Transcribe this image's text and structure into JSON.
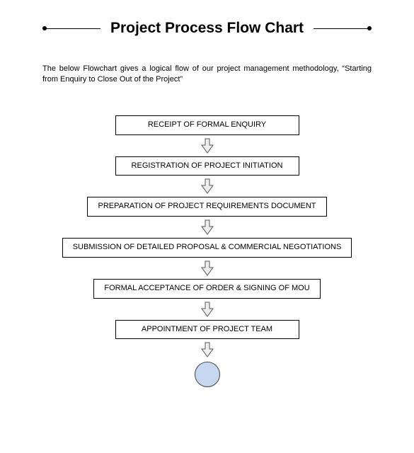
{
  "title": "Project Process Flow Chart",
  "intro": "The below Flowchart gives a logical flow of our project management methodology, “Starting from Enquiry to Close Out of the Project”",
  "steps": {
    "s1": "RECEIPT OF FORMAL ENQUIRY",
    "s2": "REGISTRATION OF PROJECT INITIATION",
    "s3": "PREPARATION OF PROJECT REQUIREMENTS DOCUMENT",
    "s4": "SUBMISSION OF DETAILED PROPOSAL & COMMERCIAL NEGOTIATIONS",
    "s5": "FORMAL ACCEPTANCE OF ORDER & SIGNING OF MOU",
    "s6": "APPOINTMENT OF PROJECT TEAM"
  }
}
